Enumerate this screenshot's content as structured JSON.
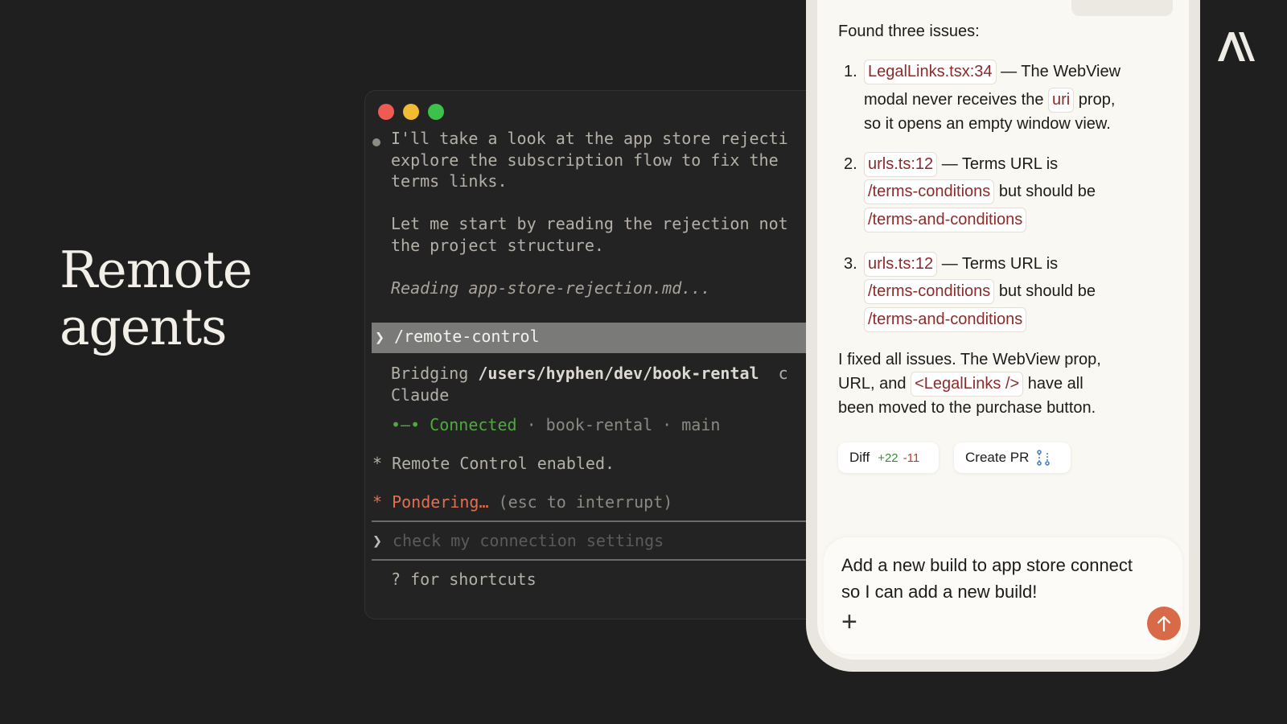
{
  "hero": {
    "line1": "Remote",
    "line2": "agents"
  },
  "terminal": {
    "lines": [
      "I'll take a look at the app store rejecti",
      "explore the subscription flow to fix the",
      "terms links.",
      "Let me start by reading the rejection not",
      "the project structure.",
      "Reading app-store-rejection.md..."
    ],
    "command": "/remote-control",
    "bridging_prefix": "Bridging ",
    "bridging_path": "/users/hyphen/dev/book-rental",
    "bridging_suffix": "  c",
    "bridging_line2": "Claude",
    "connection_icon": "•—•",
    "connected": "Connected",
    "connection_meta": " · book-rental · main",
    "enabled": "* Remote Control enabled.",
    "pondering": "* Pondering…",
    "interrupt_hint": " (esc to interrupt)",
    "input_placeholder": "check my connection settings",
    "shortcuts": "? for shortcuts"
  },
  "chat": {
    "intro": "Found three issues:",
    "issues": [
      {
        "num": "1.",
        "file": "LegalLinks.tsx:34",
        "l1_text": " — The WebView",
        "l2_text_a": "modal never receives the ",
        "l2_code": "uri",
        "l2_text_b": " prop,",
        "l3_text": "so it opens an empty window view."
      },
      {
        "num": "2.",
        "file": "urls.ts:12",
        "l1_text": " — Terms URL is",
        "l2_code": "/terms-conditions",
        "l2_text": " but should be",
        "l3_code": "/terms-and-conditions"
      },
      {
        "num": "3.",
        "file": "urls.ts:12",
        "l1_text": " — Terms URL is",
        "l2_code": "/terms-conditions",
        "l2_text": " but should be",
        "l3_code": "/terms-and-conditions"
      }
    ],
    "summary_l1": "I fixed all issues. The WebView prop,",
    "summary_l2a": "URL, and ",
    "summary_code": "<LegalLinks />",
    "summary_l2b": " have all",
    "summary_l3": "been moved to the purchase button.",
    "diff_label": "Diff",
    "diff_add": "+22",
    "diff_del": "-11",
    "pr_label": "Create PR",
    "pr_icon": "git-pull-request-icon",
    "composer_text": "Add a new build to app store connect so I can add a new build!",
    "plus_icon": "+",
    "send_icon": "arrow-up-icon"
  },
  "colors": {
    "background": "#1f1f1f",
    "accent_orange": "#d96a48",
    "code_red": "#8d2a2a",
    "connected_green": "#4eaa3e"
  }
}
